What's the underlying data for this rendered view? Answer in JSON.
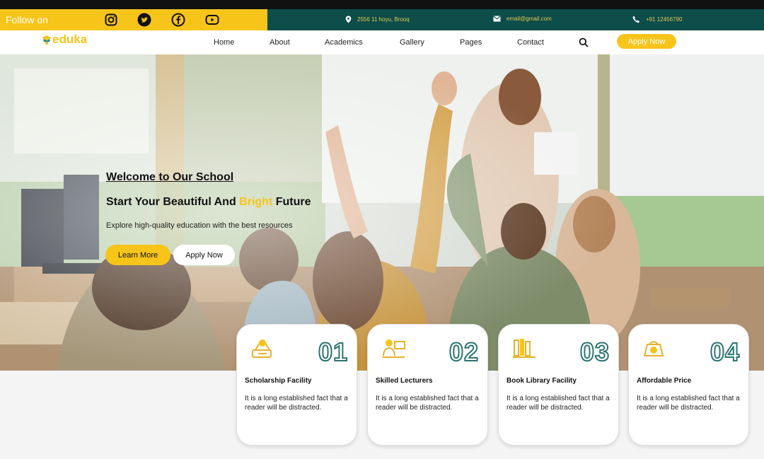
{
  "topbar": {
    "follow_label": "Follow on",
    "social": [
      "instagram-icon",
      "twitter-icon",
      "facebook-icon",
      "youtube-icon"
    ],
    "address": "2556 11 hoyu, Brooq",
    "email": "email@gmail.com",
    "phone": "+91 12456790"
  },
  "nav": {
    "logo_text": "eduka",
    "items": [
      "Home",
      "About",
      "Academics",
      "Gallery",
      "Pages",
      "Contact"
    ],
    "apply_label": "Apply Now"
  },
  "hero": {
    "welcome": "Welcome to Our School",
    "headline_pre": "Start Your Beautiful And",
    "headline_hl": "Bright",
    "headline_post": "Future",
    "subtitle": "Explore high-quality education with the best resources",
    "learn_more": "Learn More",
    "apply_now": "Apply Now"
  },
  "features": [
    {
      "num": "01",
      "title": "Scholarship Facility",
      "desc": "It is a long established fact that a reader will be distracted.",
      "icon": "scholarship-icon"
    },
    {
      "num": "02",
      "title": "Skilled Lecturers",
      "desc": "It is a long established fact that a reader will be distracted.",
      "icon": "lecturer-icon"
    },
    {
      "num": "03",
      "title": "Book Library Facility",
      "desc": "It is a long established fact that a reader will be distracted.",
      "icon": "library-icon"
    },
    {
      "num": "04",
      "title": "Affordable Price",
      "desc": "It is a long established fact that a reader will be distracted.",
      "icon": "price-icon"
    }
  ],
  "colors": {
    "accent": "#f7c41a",
    "primary": "#0d4d4a"
  }
}
